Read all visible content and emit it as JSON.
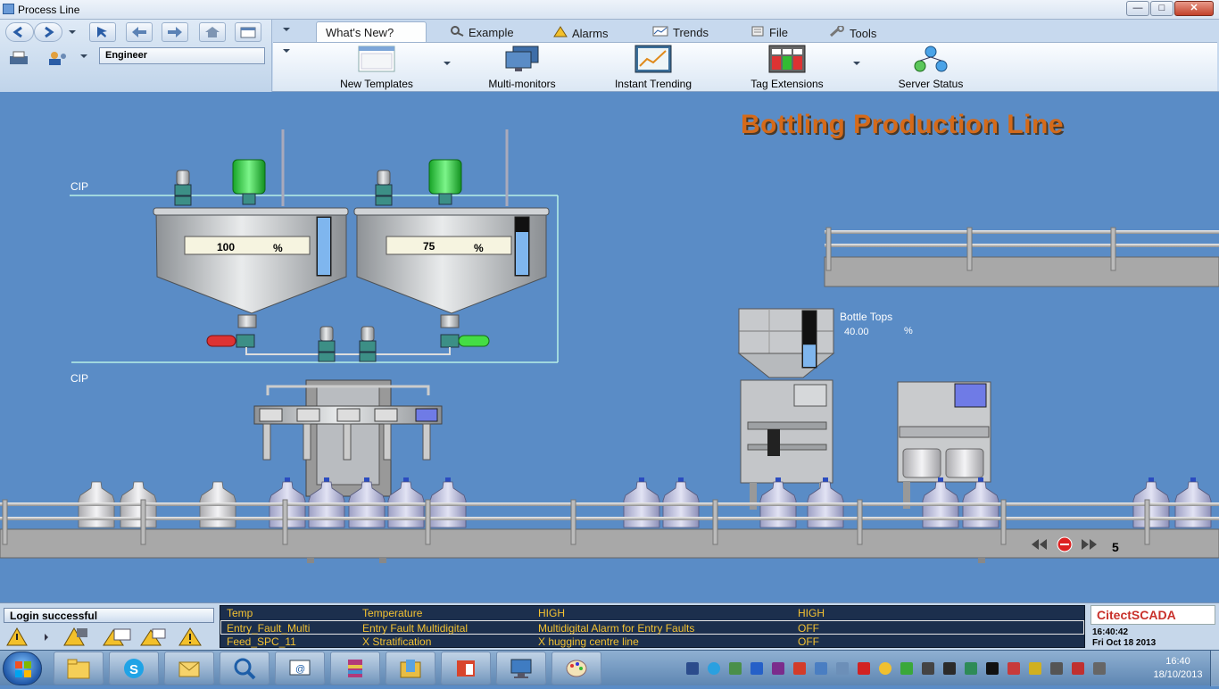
{
  "window": {
    "title": "Process Line",
    "minimize": "—",
    "maximize": "□",
    "close": "✕"
  },
  "toolbar": {
    "user": "Engineer",
    "icons": [
      "back-circle-icon",
      "forward-circle-icon",
      "cursor-icon",
      "page-back-icon",
      "page-forward-icon",
      "home-icon",
      "window-icon",
      "print-icon",
      "user-switch-icon"
    ]
  },
  "ribbon": {
    "tabs": [
      {
        "label": "What's New?",
        "icon": ""
      },
      {
        "label": "Example",
        "icon": "magnifier-icon"
      },
      {
        "label": "Alarms",
        "icon": "warning-icon"
      },
      {
        "label": "Trends",
        "icon": "trend-icon"
      },
      {
        "label": "File",
        "icon": "file-icon"
      },
      {
        "label": "Tools",
        "icon": "tools-icon"
      }
    ],
    "buttons": [
      {
        "label": "New Templates",
        "icon": "template-icon"
      },
      {
        "label": "Multi-monitors",
        "icon": "monitors-icon"
      },
      {
        "label": "Instant Trending",
        "icon": "trending-icon"
      },
      {
        "label": "Tag Extensions",
        "icon": "tag-extension-icon"
      },
      {
        "label": "Server Status",
        "icon": "server-status-icon"
      }
    ]
  },
  "main": {
    "title": "Bottling Production Line",
    "cip_top": "CIP",
    "cip_bottom": "CIP",
    "tank1": {
      "level": "100",
      "unit": "%",
      "fill": 1.0
    },
    "tank2": {
      "level": "75",
      "unit": "%",
      "fill": 0.75
    },
    "bottle_tops": {
      "label": "Bottle Tops",
      "value": "40.00",
      "unit": "%",
      "fill": 0.4
    },
    "page_number": "5",
    "colors": {
      "background": "#5a8cc6",
      "title": "#d46a1a",
      "motor": "#22d435",
      "valve_open": "#44dd44",
      "valve_closed": "#dd3333"
    }
  },
  "status": {
    "message": "Login successful"
  },
  "alarms": [
    {
      "tag": "Temp",
      "name": "Temperature",
      "description": "HIGH",
      "state": "HIGH"
    },
    {
      "tag": "Entry_Fault_Multi",
      "name": "Entry Fault Multidigital",
      "description": "Multidigital Alarm for Entry Faults",
      "state": "OFF"
    },
    {
      "tag": "Feed_SPC_11",
      "name": "X Stratification",
      "description": "X hugging centre line",
      "state": "OFF"
    }
  ],
  "brand": {
    "logo": "CitectSCADA",
    "time": "16:40:42",
    "date": "Fri Oct 18 2013"
  },
  "taskbar": {
    "time": "16:40",
    "date": "18/10/2013",
    "apps": [
      "explorer-icon",
      "skype-icon",
      "outlook-icon",
      "search-icon",
      "email-icon",
      "winrar-icon",
      "folder-icon",
      "office-icon",
      "computer-icon",
      "paint-icon"
    ]
  }
}
